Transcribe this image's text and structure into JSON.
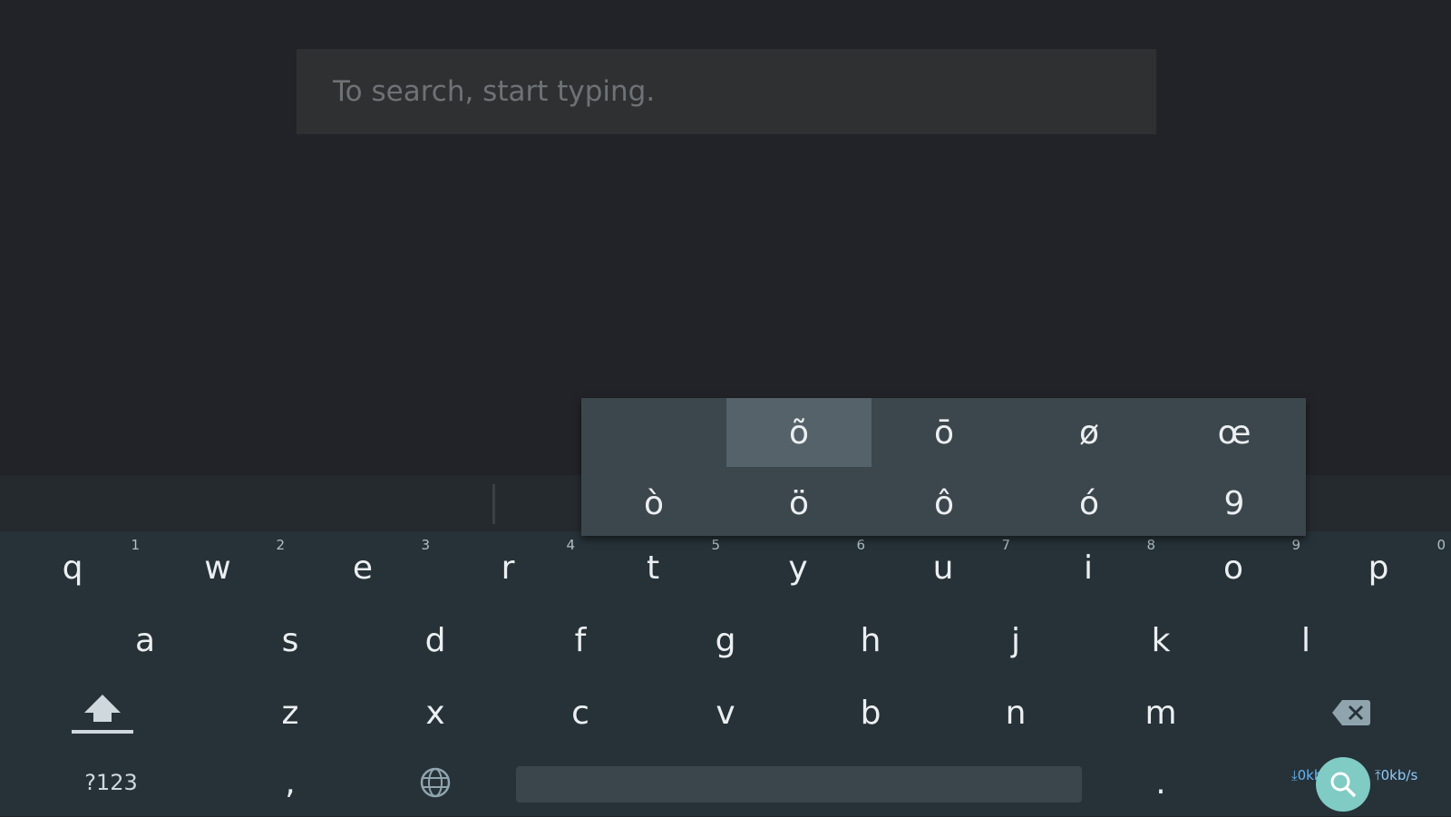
{
  "search": {
    "placeholder": "To search, start typing.",
    "value": ""
  },
  "popup": {
    "row1": [
      "",
      "õ",
      "ō",
      "ø",
      "œ"
    ],
    "row2": [
      "ò",
      "ö",
      "ô",
      "ó",
      "9"
    ],
    "selected": "õ"
  },
  "keyboard": {
    "row1": [
      {
        "label": "q",
        "hint": "1"
      },
      {
        "label": "w",
        "hint": "2"
      },
      {
        "label": "e",
        "hint": "3"
      },
      {
        "label": "r",
        "hint": "4"
      },
      {
        "label": "t",
        "hint": "5"
      },
      {
        "label": "y",
        "hint": "6"
      },
      {
        "label": "u",
        "hint": "7"
      },
      {
        "label": "i",
        "hint": "8"
      },
      {
        "label": "o",
        "hint": "9"
      },
      {
        "label": "p",
        "hint": "0"
      }
    ],
    "row2": [
      "a",
      "s",
      "d",
      "f",
      "g",
      "h",
      "j",
      "k",
      "l"
    ],
    "row3": [
      "z",
      "x",
      "c",
      "v",
      "b",
      "n",
      "m"
    ],
    "symbols_label": "?123",
    "comma_label": ",",
    "period_label": "."
  },
  "status": {
    "download_speed": "0kb/s",
    "upload_speed": "0kb/s"
  },
  "colors": {
    "accent": "#80cbc4",
    "background": "#212328",
    "keyboard": "#263238"
  },
  "icons": [
    "shift-icon",
    "backspace-icon",
    "globe-icon",
    "search-icon",
    "download-arrow-icon",
    "upload-arrow-icon"
  ]
}
